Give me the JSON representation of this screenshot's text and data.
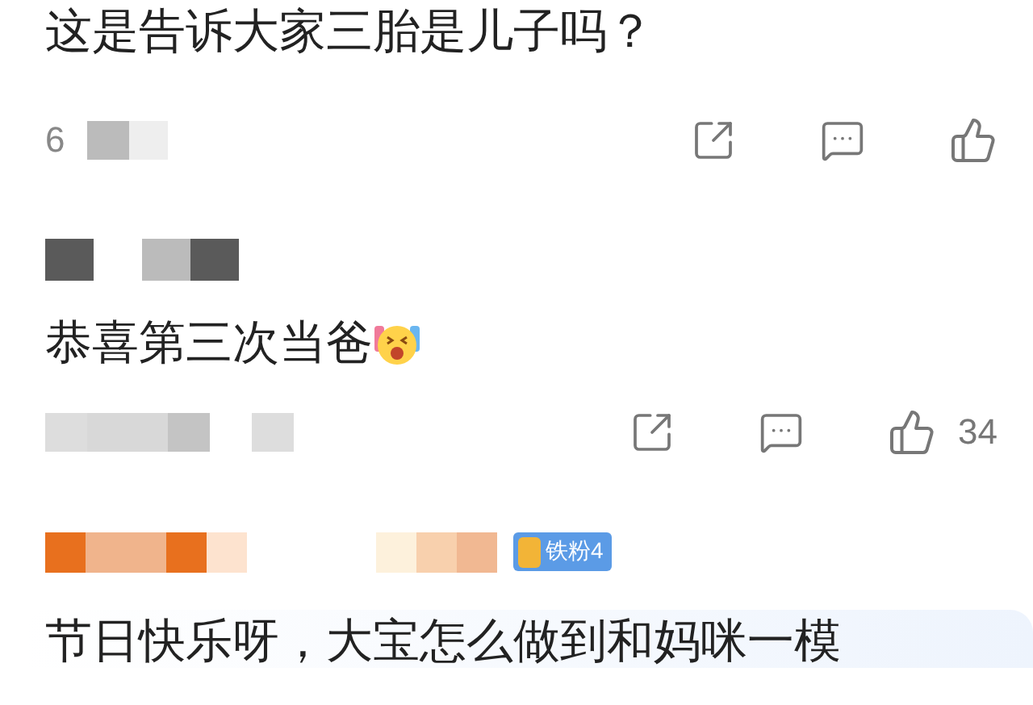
{
  "comments": [
    {
      "kind": "continued",
      "lines": [
        "这是告诉大家三胎是儿子吗？"
      ],
      "emoji": false,
      "meta": "6",
      "show_actions": true,
      "highlighted": false
    },
    {
      "kind": "plain",
      "lines": [
        "恭喜第三次当爸"
      ],
      "emoji": true,
      "show_actions": true,
      "likes": "34",
      "highlighted": false
    },
    {
      "kind": "fan",
      "lines": [
        "节日快乐呀，大宝怎么做到和妈咪一模"
      ],
      "emoji": false,
      "badge": "铁粉4",
      "show_actions": false,
      "highlighted": true
    }
  ]
}
